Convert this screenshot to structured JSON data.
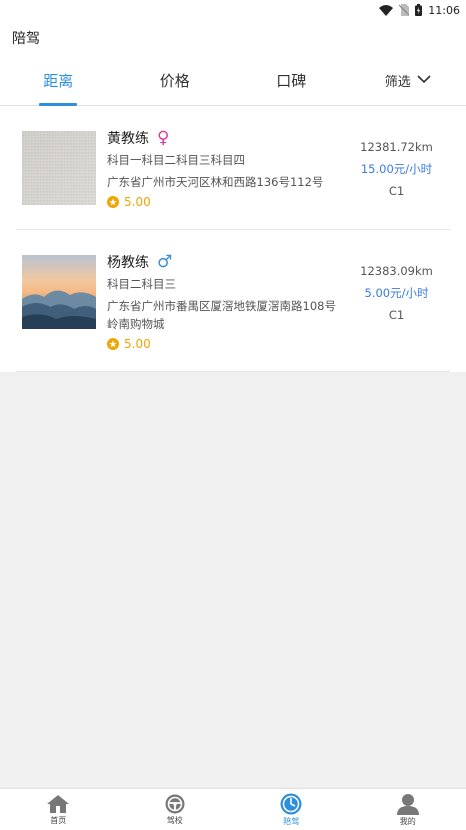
{
  "status_bar": {
    "time": "11:06"
  },
  "header": {
    "title": "陪驾"
  },
  "tabs": [
    {
      "label": "距离",
      "active": true
    },
    {
      "label": "价格",
      "active": false
    },
    {
      "label": "口碑",
      "active": false
    },
    {
      "label": "筛选",
      "active": false
    }
  ],
  "coaches": [
    {
      "name": "黄教练",
      "gender": "female",
      "gender_symbol": "♀",
      "subjects": "科目一科目二科目三科目四",
      "address": "广东省广州市天河区林和西路136号112号",
      "rating": "5.00",
      "distance": "12381.72km",
      "price": "15.00元/小时",
      "license": "C1",
      "thumbnail_icon": "texture-photo"
    },
    {
      "name": "杨教练",
      "gender": "male",
      "gender_symbol": "♂",
      "subjects": "科目二科目三",
      "address": "广东省广州市番禺区厦滘地铁厦滘南路108号岭南购物城",
      "rating": "5.00",
      "distance": "12383.09km",
      "price": "5.00元/小时",
      "license": "C1",
      "thumbnail_icon": "mountain-photo"
    }
  ],
  "bottom_nav": [
    {
      "label": "首页",
      "icon": "home-icon",
      "active": false
    },
    {
      "label": "驾校",
      "icon": "steering-wheel-icon",
      "active": false
    },
    {
      "label": "陪驾",
      "icon": "compass-icon",
      "active": true
    },
    {
      "label": "我的",
      "icon": "user-icon",
      "active": false
    }
  ],
  "colors": {
    "accent": "#2f8fdf",
    "price": "#3a7be0",
    "rating": "#f0a500",
    "female": "#d63fa6",
    "male": "#3b8fd9"
  }
}
